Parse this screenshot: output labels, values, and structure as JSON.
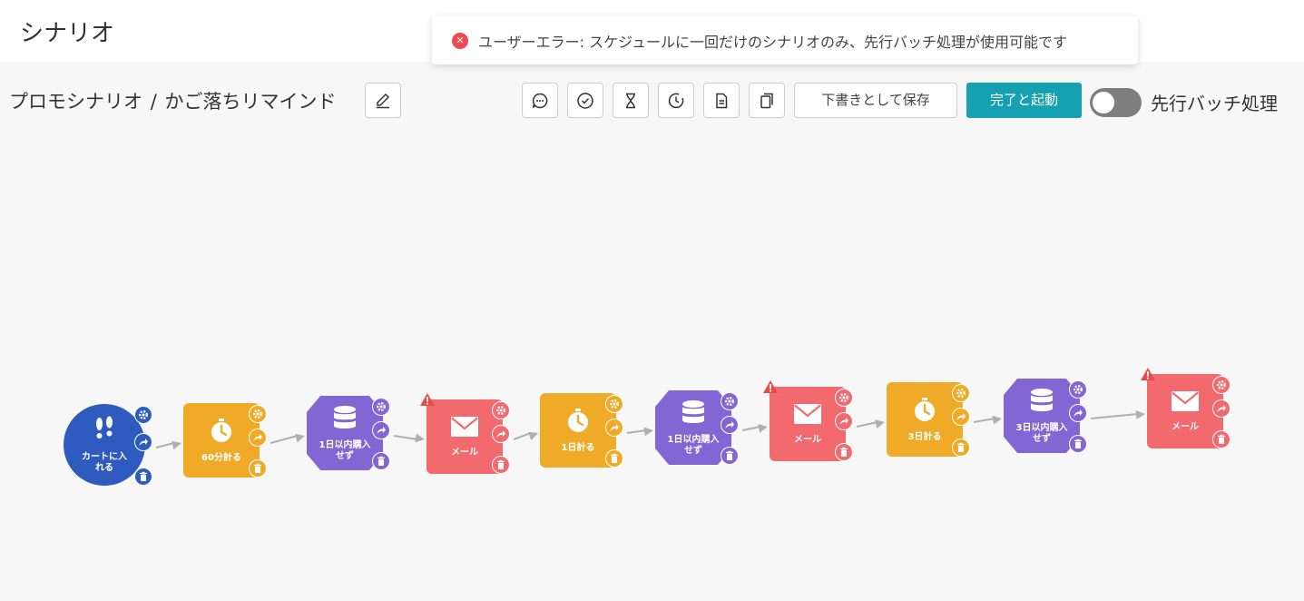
{
  "header": {
    "title": "シナリオ"
  },
  "toast": {
    "message": "ユーザーエラー: スケジュールに一回だけのシナリオのみ、先行バッチ処理が使用可能です",
    "icon": "error-icon"
  },
  "breadcrumb": {
    "parent": "プロモシナリオ",
    "separator": "/",
    "current": "かご落ちリマインド"
  },
  "toolbar": {
    "icons": [
      "chat-icon",
      "check-circle-icon",
      "hourglass-icon",
      "clock-icon",
      "document-icon",
      "copy-icon"
    ],
    "save_draft_label": "下書きとして保存",
    "launch_label": "完了と起動",
    "batch_label": "先行バッチ処理",
    "batch_enabled": false
  },
  "colors": {
    "trigger": "#2f5bbf",
    "wait": "#efab28",
    "condition": "#8266d4",
    "mail": "#f26a6e",
    "accent": "#15a1b2"
  },
  "nodes": [
    {
      "type": "trigger",
      "label": "カートに入\nれる",
      "icon": "footprints-icon",
      "warning": false
    },
    {
      "type": "wait",
      "label": "60分計る",
      "icon": "stopwatch-icon",
      "warning": false
    },
    {
      "type": "condition",
      "label": "1日以内購入\nせず",
      "icon": "database-icon",
      "warning": false
    },
    {
      "type": "mail",
      "label": "メール",
      "icon": "envelope-icon",
      "warning": true
    },
    {
      "type": "wait",
      "label": "1日計る",
      "icon": "stopwatch-icon",
      "warning": false
    },
    {
      "type": "condition",
      "label": "1日以内購入\nせず",
      "icon": "database-icon",
      "warning": false
    },
    {
      "type": "mail",
      "label": "メール",
      "icon": "envelope-icon",
      "warning": true
    },
    {
      "type": "wait",
      "label": "3日計る",
      "icon": "stopwatch-icon",
      "warning": false
    },
    {
      "type": "condition",
      "label": "3日以内購入\nせず",
      "icon": "database-icon",
      "warning": false
    },
    {
      "type": "mail",
      "label": "メール",
      "icon": "envelope-icon",
      "warning": true
    }
  ]
}
